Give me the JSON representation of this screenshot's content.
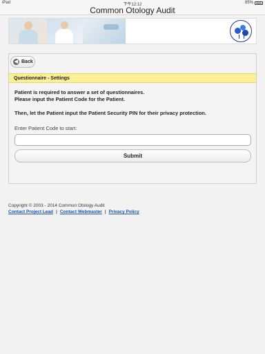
{
  "status_bar": {
    "device": "iPad",
    "time": "下午12:12",
    "battery": "85%"
  },
  "app": {
    "title": "Common Otology Audit"
  },
  "nav": {
    "back_label": "Back"
  },
  "section": {
    "header": "Questionnaire - Settings",
    "instructions": [
      "Patient is required to answer a set of questionnaires.",
      "Please input the Patient Code for the Patient.",
      "Then, let the Patient input the Patient Security PIN for their privacy protection."
    ],
    "code_label": "Enter Patient Code to start:",
    "code_value": "",
    "code_placeholder": "",
    "submit_label": "Submit"
  },
  "footer": {
    "copyright": "Copyright © 2003 - 2014 Common Otology Audit",
    "links": [
      "Contact Project Lead",
      "Contact Webmaster",
      "Privacy Policy"
    ],
    "separator": "|"
  },
  "colors": {
    "header_bg": "#fbef9a",
    "link": "#1a52a8",
    "logo": "#2a5cc7"
  }
}
